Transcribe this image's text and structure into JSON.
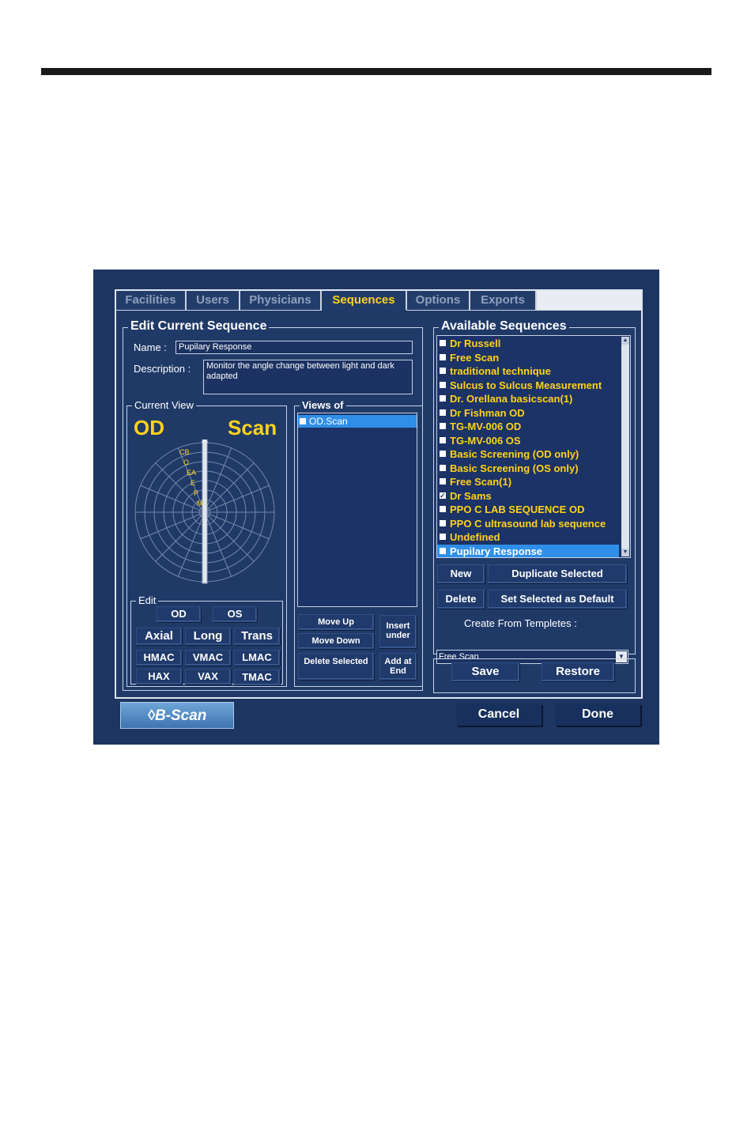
{
  "tabs": [
    "Facilities",
    "Users",
    "Physicians",
    "Sequences",
    "Options",
    "Exports"
  ],
  "active_tab": "Sequences",
  "edit": {
    "title": "Edit Current Sequence",
    "name_label": "Name :",
    "name_value": "Pupilary Response",
    "description_label": "Description :",
    "description_value": "Monitor the angle change between light and dark adapted"
  },
  "current_view": {
    "title": "Current View",
    "eye": "OD",
    "mode": "Scan",
    "diagram_labels": [
      "CB",
      "O",
      "EA",
      "E",
      "P",
      "M"
    ]
  },
  "edit_group": {
    "title": "Edit",
    "buttons": [
      "OD",
      "OS",
      "Axial",
      "Long",
      "Trans",
      "HMAC",
      "VMAC",
      "LMAC",
      "HAX",
      "VAX",
      "TMAC"
    ]
  },
  "views": {
    "title": "Views of",
    "items": [
      "OD.Scan"
    ],
    "move_up": "Move Up",
    "move_down": "Move Down",
    "insert_under": "Insert under",
    "delete_selected": "Delete Selected",
    "add_at_end": "Add at End"
  },
  "available": {
    "title": "Available Sequences",
    "items": [
      "Dr Russell",
      "Free Scan",
      "traditional technique",
      "Sulcus to Sulcus Measurement",
      "Dr. Orellana basicscan(1)",
      "Dr Fishman OD",
      "TG-MV-006 OD",
      "TG-MV-006 OS",
      "Basic Screening (OD only)",
      "Basic Screening (OS only)",
      "Free Scan(1)",
      "Dr Sams",
      "PPO C LAB SEQUENCE  OD",
      "PPO C ultrasound lab sequence",
      "Undefined",
      "Pupilary Response"
    ],
    "checked_index": 11,
    "selected_index": 15,
    "new": "New",
    "duplicate": "Duplicate Selected",
    "delete": "Delete",
    "set_default": "Set Selected as Default",
    "create_label": "Create From Templetes :",
    "template_value": "Free Scan",
    "save": "Save",
    "restore": "Restore"
  },
  "footer": {
    "logo": "B-Scan",
    "cancel": "Cancel",
    "done": "Done"
  },
  "colors": {
    "background": "#1d3561",
    "accent_yellow": "#ffd21a",
    "selection_blue": "#2f8fe8"
  }
}
